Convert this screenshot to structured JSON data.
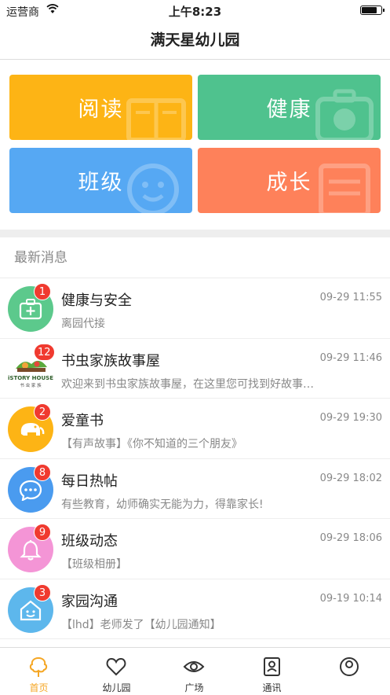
{
  "status_bar": {
    "carrier": "运营商",
    "time": "上午8:23"
  },
  "header": {
    "title": "满天星幼儿园"
  },
  "tiles": [
    {
      "label": "阅读",
      "color": "#FDB415"
    },
    {
      "label": "健康",
      "color": "#4FC28E"
    },
    {
      "label": "班级",
      "color": "#56A8F3"
    },
    {
      "label": "成长",
      "color": "#FE815A"
    }
  ],
  "section": {
    "title": "最新消息"
  },
  "messages": [
    {
      "title": "健康与安全",
      "time": "09-29 11:55",
      "preview": "离园代接",
      "badge": "1",
      "icon": "first-aid-kit-icon"
    },
    {
      "title": "书虫家族故事屋",
      "time": "09-29 11:46",
      "preview": "欢迎来到书虫家族故事屋，在这里您可找到好故事…",
      "badge": "12",
      "icon": "istory-house-logo",
      "logo_text": "iSTORY HOUSE",
      "logo_sub": "书 虫 家 族"
    },
    {
      "title": "爱童书",
      "time": "09-29 19:30",
      "preview": "【有声故事】《你不知道的三个朋友》",
      "badge": "2",
      "icon": "elephant-icon"
    },
    {
      "title": "每日热帖",
      "time": "09-29 18:02",
      "preview": "有些教育，幼师确实无能为力，得靠家长!",
      "badge": "8",
      "icon": "chat-bubble-icon"
    },
    {
      "title": "班级动态",
      "time": "09-29 18:06",
      "preview": "【班级相册】",
      "badge": "9",
      "icon": "bell-icon"
    },
    {
      "title": "家园沟通",
      "time": "09-19 10:14",
      "preview": "【lhd】老师发了【幼儿园通知】",
      "badge": "3",
      "icon": "house-icon"
    }
  ],
  "tabs": [
    {
      "label": "首页",
      "icon": "home-tree-icon",
      "active": true
    },
    {
      "label": "幼儿园",
      "icon": "heart-icon"
    },
    {
      "label": "广场",
      "icon": "eye-icon"
    },
    {
      "label": "通讯",
      "icon": "contacts-icon"
    },
    {
      "label": "",
      "icon": "profile-icon"
    }
  ],
  "colors": {
    "accent": "#F5A623",
    "badge": "#F03A2F"
  }
}
